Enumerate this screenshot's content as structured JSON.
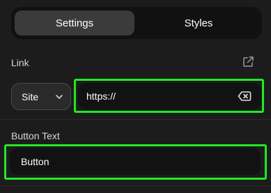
{
  "tabs": [
    {
      "label": "Settings",
      "active": true
    },
    {
      "label": "Styles",
      "active": false
    }
  ],
  "link": {
    "label": "Link",
    "external_icon": "external-link-icon",
    "site_select": {
      "value": "Site",
      "icon": "chevron-down-icon"
    },
    "url_input": {
      "value": "https://",
      "clear_icon": "backspace-clear-icon"
    }
  },
  "button_text": {
    "label": "Button Text",
    "value": "Button"
  },
  "colors": {
    "background": "#1c1c1c",
    "input_background": "#121212",
    "active_tab": "#3b3b3b",
    "highlight": "#22e822"
  }
}
